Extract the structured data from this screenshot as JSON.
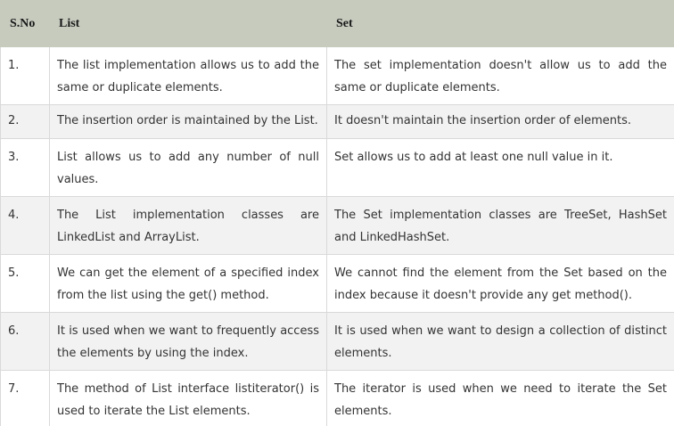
{
  "table": {
    "headers": {
      "sno": "S.No",
      "list": "List",
      "set": "Set"
    },
    "rows": [
      {
        "sno": "1.",
        "list": "The list implementation allows us to add the same or duplicate elements.",
        "set": "The set implementation doesn't allow us to add the same or duplicate elements."
      },
      {
        "sno": "2.",
        "list": "The insertion order is maintained by the List.",
        "set": "It doesn't maintain the insertion order of elements."
      },
      {
        "sno": "3.",
        "list": "List allows us to add any number of null values.",
        "set": "Set allows us to add at least one null value in it."
      },
      {
        "sno": "4.",
        "list": "The List implementation classes are LinkedList and ArrayList.",
        "set": "The Set implementation classes are TreeSet, HashSet and LinkedHashSet."
      },
      {
        "sno": "5.",
        "list": "We can get the element of a specified index from the list using the get() method.",
        "set": "We cannot find the element from the Set based on the index because it doesn't provide any get method()."
      },
      {
        "sno": "6.",
        "list": "It is used when we want to frequently access the elements by using the index.",
        "set": "It is used when we want to design a collection of distinct elements."
      },
      {
        "sno": "7.",
        "list": "The method of List interface listiterator() is used to iterate the List elements.",
        "set": "The iterator is used when we need to iterate the Set elements."
      }
    ]
  }
}
